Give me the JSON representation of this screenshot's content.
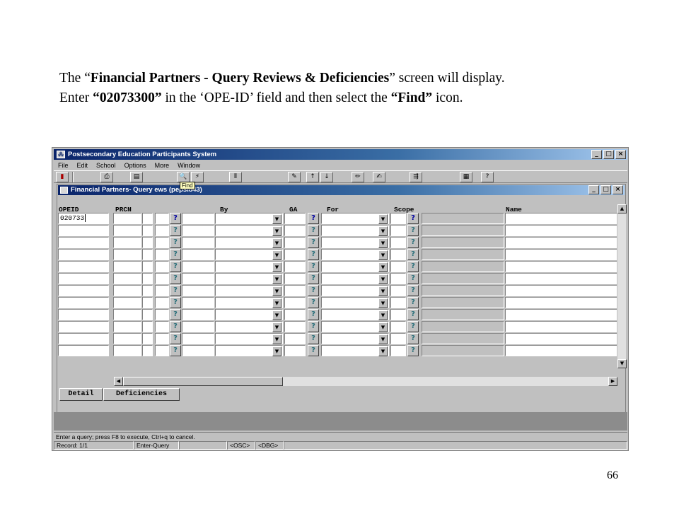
{
  "instruction": {
    "line1_prefix": "The “",
    "line1_bold": "Financial Partners - Query Reviews & Deficiencies",
    "line1_suffix": "” screen will display.",
    "line2_prefix": "Enter ",
    "line2_bold1": "“02073300”",
    "line2_mid": " in the ‘OPE-ID’  field and then select the ",
    "line2_bold2": "“Find”",
    "line2_suffix": " icon."
  },
  "page_number": "66",
  "app": {
    "title": "Postsecondary Education Participants System",
    "menu": [
      "File",
      "Edit",
      "School",
      "Options",
      "More",
      "Window"
    ],
    "tooltip": "Find"
  },
  "inner_window": {
    "title": "Financial Partners- Query     ews (pepsi843)"
  },
  "columns": {
    "opeid": "OPEID",
    "prcn": "PRCN",
    "by": "By",
    "ga": "GA",
    "for": "For",
    "scope": "Scope",
    "name": "Name"
  },
  "first_row": {
    "opeid_value": "020733"
  },
  "row_count": 12,
  "buttons": {
    "detail": "Detail",
    "deficiencies": "Deficiencies"
  },
  "status": {
    "message": "Enter a query;  press F8 to execute, Ctrl+q  to cancel.",
    "record": "Record: 1/1",
    "mode": "Enter-Query",
    "osc": "<OSC>",
    "dbg": "<DBG>"
  },
  "colors": {
    "title_start": "#0a246a",
    "title_end": "#a6caf0",
    "face": "#c0c0c0"
  }
}
